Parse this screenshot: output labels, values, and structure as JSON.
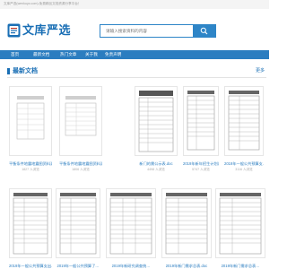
{
  "header": {
    "topline_text": "文库严选(wenkuyx.com)-免费精品文档资源分享平台！",
    "logo_text": "文库严选",
    "search_placeholder": "请输入搜索资料的内容"
  },
  "nav": {
    "items": [
      "首页",
      "最新文档",
      "热门文章",
      "关于我",
      "免责声明"
    ]
  },
  "section": {
    "title": "最新文档",
    "more": "更多"
  },
  "documents": [
    {
      "title": "平衡条件地震地震图资料汇…",
      "meta": "1827 人浏览"
    },
    {
      "title": "平衡条件地震地震图资料汇…",
      "meta": "1806 人浏览"
    },
    {
      "title": "新门的需公示表.doc",
      "meta": "4498 人浏览"
    },
    {
      "title": "2019年新年招生计划总表.doc",
      "meta": "5747 人浏览"
    },
    {
      "title": "2019年一般公共预算支…",
      "meta": "3116 人浏览"
    },
    {
      "title": "2019年一般公共预算支出…",
      "meta": ""
    },
    {
      "title": "2019年一般公共预算了…",
      "meta": ""
    },
    {
      "title": "2019年新研究调查统…",
      "meta": ""
    },
    {
      "title": "2019年新门需求总表.doc",
      "meta": ""
    },
    {
      "title": "2019年新门需求总表…",
      "meta": ""
    }
  ],
  "colors": {
    "brand": "#1a6fb5",
    "nav_bg": "#2b7dc0",
    "search_border": "#2e85c7"
  },
  "icons": [
    "logo-icon",
    "search-icon",
    "section-icon"
  ]
}
